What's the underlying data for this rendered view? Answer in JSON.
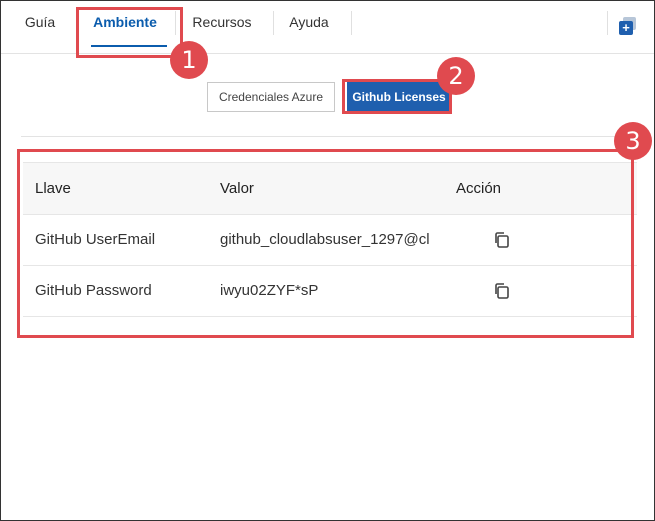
{
  "tabs": [
    {
      "label": "Guía"
    },
    {
      "label": "Ambiente",
      "active": true
    },
    {
      "label": "Recursos"
    },
    {
      "label": "Ayuda"
    }
  ],
  "expand_icon": "expand-panel-icon",
  "segments": {
    "azure_label": "Credenciales Azure",
    "github_label": "Github Licenses",
    "selected": "Github Licenses"
  },
  "table": {
    "headers": {
      "key": "Llave",
      "value": "Valor",
      "action": "Acción"
    },
    "rows": [
      {
        "key": "GitHub UserEmail",
        "value": "github_cloudlabsuser_1297@cl",
        "action_icon": "copy-icon"
      },
      {
        "key": "GitHub Password",
        "value": "iwyu02ZYF*sP",
        "action_icon": "copy-icon"
      }
    ]
  },
  "annotations": [
    "1",
    "2",
    "3"
  ],
  "colors": {
    "accent": "#1f5fae",
    "active_tab": "#0b5cad",
    "annotation": "#e04a4f"
  }
}
